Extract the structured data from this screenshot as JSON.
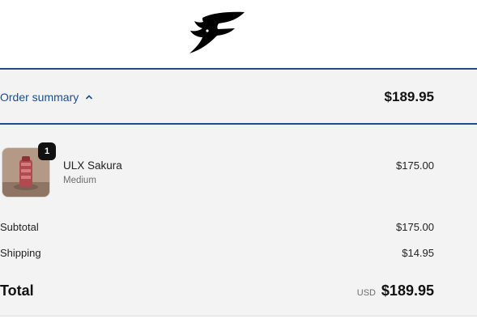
{
  "header": {
    "logo_icon": "falcon-f-logo-icon"
  },
  "order_summary": {
    "toggle_label": "Order summary",
    "toggle_icon": "chevron-up-icon",
    "total": "$189.95"
  },
  "line_items": [
    {
      "name": "ULX Sakura",
      "variant": "Medium",
      "price": "$175.00",
      "quantity": "1",
      "image_icon": "product-thumbnail"
    }
  ],
  "totals": {
    "subtotal_label": "Subtotal",
    "subtotal_value": "$175.00",
    "shipping_label": "Shipping",
    "shipping_value": "$14.95",
    "total_label": "Total",
    "currency": "USD",
    "total_value": "$189.95"
  },
  "colors": {
    "accent": "#1a4e8c",
    "panel_bg": "#f3f3f3"
  }
}
